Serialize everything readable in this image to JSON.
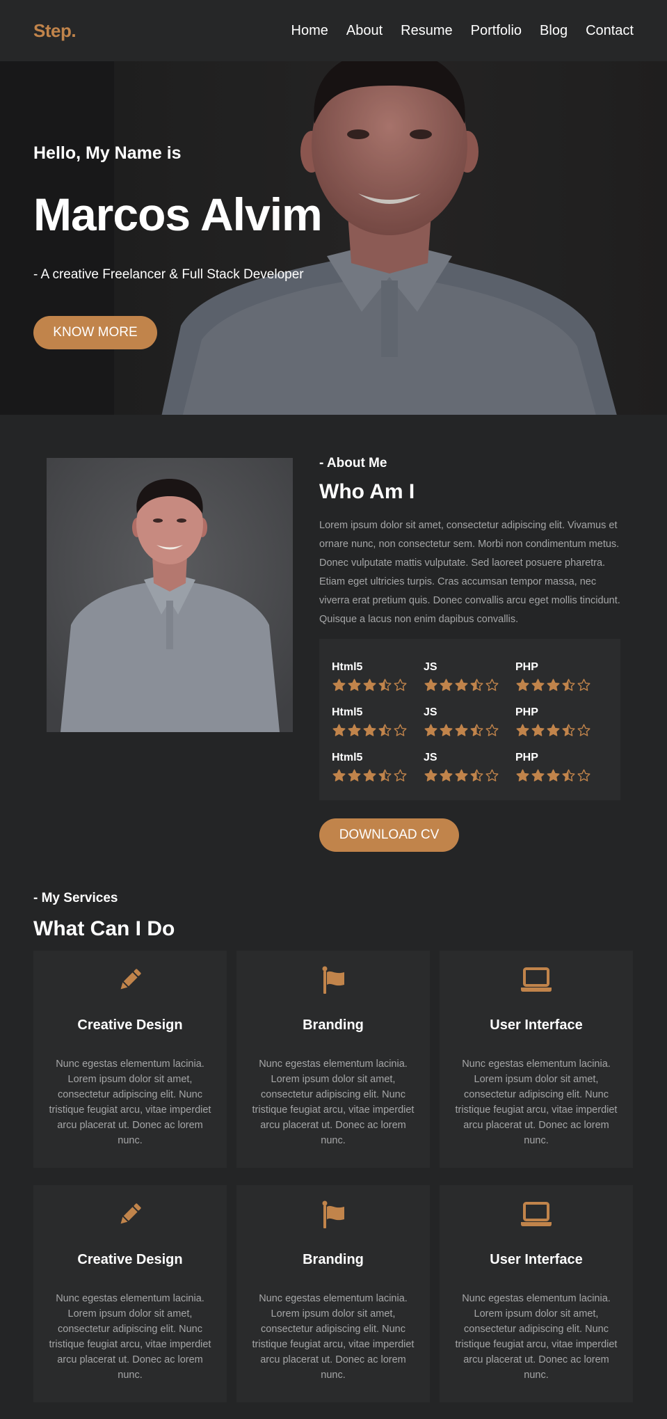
{
  "nav": {
    "logo": "Step.",
    "items": [
      "Home",
      "About",
      "Resume",
      "Portfolio",
      "Blog",
      "Contact"
    ]
  },
  "hero": {
    "greeting": "Hello, My Name is",
    "name": "Marcos Alvim",
    "subtitle": "- A creative Freelancer & Full Stack Developer",
    "button": "KNOW MORE"
  },
  "about": {
    "kicker": "- About Me",
    "title": "Who Am I",
    "text": "Lorem ipsum dolor sit amet, consectetur adipiscing elit. Vivamus et ornare nunc, non consectetur sem. Morbi non condimentum metus. Donec vulputate mattis vulputate. Sed laoreet posuere pharetra. Etiam eget ultricies turpis. Cras accumsan tempor massa, nec viverra erat pretium quis. Donec convallis arcu eget mollis tincidunt. Quisque a lacus non enim dapibus convallis.",
    "skills": [
      {
        "name": "Html5",
        "rating": 3.5
      },
      {
        "name": "JS",
        "rating": 3.5
      },
      {
        "name": "PHP",
        "rating": 3.5
      },
      {
        "name": "Html5",
        "rating": 3.5
      },
      {
        "name": "JS",
        "rating": 3.5
      },
      {
        "name": "PHP",
        "rating": 3.5
      },
      {
        "name": "Html5",
        "rating": 3.5
      },
      {
        "name": "JS",
        "rating": 3.5
      },
      {
        "name": "PHP",
        "rating": 3.5
      }
    ],
    "cv_button": "DOWNLOAD CV"
  },
  "services": {
    "kicker": "- My Services",
    "title": "What Can I Do",
    "cards": [
      {
        "icon": "pencil-icon",
        "title": "Creative Design",
        "text": "Nunc egestas elementum lacinia. Lorem ipsum dolor sit amet, consectetur adipiscing elit. Nunc tristique feugiat arcu, vitae imperdiet arcu placerat ut. Donec ac lorem nunc."
      },
      {
        "icon": "flag-icon",
        "title": "Branding",
        "text": "Nunc egestas elementum lacinia. Lorem ipsum dolor sit amet, consectetur adipiscing elit. Nunc tristique feugiat arcu, vitae imperdiet arcu placerat ut. Donec ac lorem nunc."
      },
      {
        "icon": "laptop-icon",
        "title": "User Interface",
        "text": "Nunc egestas elementum lacinia. Lorem ipsum dolor sit amet, consectetur adipiscing elit. Nunc tristique feugiat arcu, vitae imperdiet arcu placerat ut. Donec ac lorem nunc."
      },
      {
        "icon": "pencil-icon",
        "title": "Creative Design",
        "text": "Nunc egestas elementum lacinia. Lorem ipsum dolor sit amet, consectetur adipiscing elit. Nunc tristique feugiat arcu, vitae imperdiet arcu placerat ut. Donec ac lorem nunc."
      },
      {
        "icon": "flag-icon",
        "title": "Branding",
        "text": "Nunc egestas elementum lacinia. Lorem ipsum dolor sit amet, consectetur adipiscing elit. Nunc tristique feugiat arcu, vitae imperdiet arcu placerat ut. Donec ac lorem nunc."
      },
      {
        "icon": "laptop-icon",
        "title": "User Interface",
        "text": "Nunc egestas elementum lacinia. Lorem ipsum dolor sit amet, consectetur adipiscing elit. Nunc tristique feugiat arcu, vitae imperdiet arcu placerat ut. Donec ac lorem nunc."
      }
    ]
  },
  "colors": {
    "accent": "#c1844b",
    "background": "#242526",
    "card": "#2a2b2c",
    "muted_text": "#a5a6a7"
  }
}
